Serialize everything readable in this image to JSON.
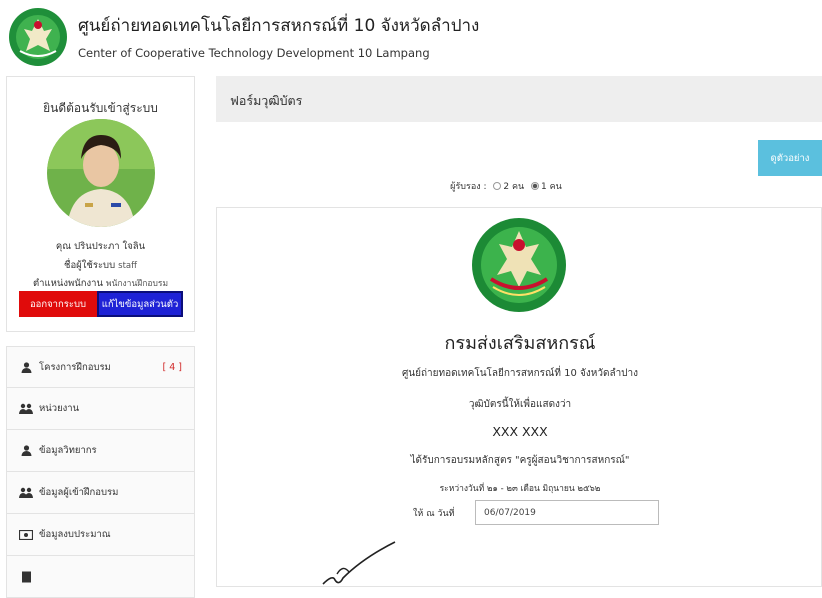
{
  "header": {
    "title": "ศูนย์ถ่ายทอดเทคโนโลยีการสหกรณ์ที่ 10 จังหวัดลำปาง",
    "subtitle": "Center of Cooperative Technology Development 10 Lampang"
  },
  "sidebar": {
    "welcome": "ยินดีต้อนรับเข้าสู่ระบบ",
    "user_name": "คุณ ปรินประภา ใจลิน",
    "username_label": "ชื่อผู้ใช้ระบบ",
    "username_value": "staff",
    "position_label": "ตำแหน่งพนักงาน",
    "position_value": "พนักงานฝึกอบรม",
    "logout_label": "ออกจากระบบ",
    "edit_profile_label": "แก้ไขข้อมูลส่วนตัว",
    "menu": [
      {
        "label": "โครงการฝึกอบรม",
        "icon": "user-icon",
        "count": "[ 4 ]"
      },
      {
        "label": "หน่วยงาน",
        "icon": "users-icon"
      },
      {
        "label": "ข้อมูลวิทยากร",
        "icon": "user-icon"
      },
      {
        "label": "ข้อมูลผู้เข้าฝึกอบรม",
        "icon": "users-icon"
      },
      {
        "label": "ข้อมูลงบประมาณ",
        "icon": "money-icon"
      }
    ]
  },
  "main": {
    "panel_title": "ฟอร์มวุฒิบัตร",
    "preview_button": "ดูตัวอย่าง",
    "signer_label": "ผู้รับรอง :",
    "signer_options": [
      "2 คน",
      "1 คน"
    ],
    "signer_selected": "1 คน",
    "certificate": {
      "department": "กรมส่งเสริมสหกรณ์",
      "center": "ศูนย์ถ่ายทอดเทคโนโลยีการสหกรณ์ที่ 10 จังหวัดลำปาง",
      "certify_text": "วุฒิบัตรนี้ให้เพื่อแสดงว่า",
      "recipient": "XXX XXX",
      "course": "ได้รับการอบรมหลักสูตร \"ครูผู้สอนวิชาการสหกรณ์\"",
      "period": "ระหว่างวันที่ ๒๑ - ๒๓ เดือน มิถุนายน ๒๕๖๒",
      "given_label": "ให้ ณ วันที่",
      "given_date": "06/07/2019"
    }
  },
  "colors": {
    "logout": "#e00b0b",
    "edit_profile": "#1e22d6",
    "preview": "#5bc0de",
    "count": "#d12a2a",
    "panel_head": "#eeeeee"
  }
}
